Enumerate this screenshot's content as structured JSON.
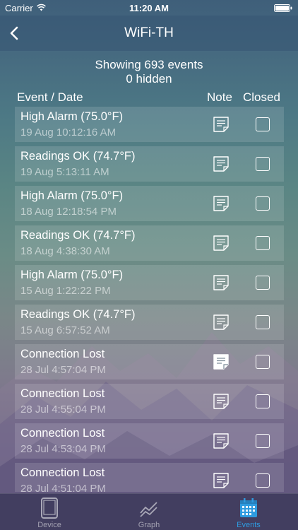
{
  "status_bar": {
    "carrier": "Carrier",
    "time": "11:20 AM"
  },
  "nav": {
    "title": "WiFi-TH"
  },
  "summary": {
    "showing": "Showing 693 events",
    "hidden": "0 hidden"
  },
  "columns": {
    "event": "Event / Date",
    "note": "Note",
    "closed": "Closed"
  },
  "events": [
    {
      "title": "High Alarm (75.0°F)",
      "date": "19 Aug 10:12:16 AM",
      "has_note": false,
      "closed": false
    },
    {
      "title": "Readings OK (74.7°F)",
      "date": "19 Aug 5:13:11 AM",
      "has_note": false,
      "closed": false
    },
    {
      "title": "High Alarm (75.0°F)",
      "date": "18 Aug 12:18:54 PM",
      "has_note": false,
      "closed": false
    },
    {
      "title": "Readings OK (74.7°F)",
      "date": "18 Aug 4:38:30 AM",
      "has_note": false,
      "closed": false
    },
    {
      "title": "High Alarm (75.0°F)",
      "date": "15 Aug 1:22:22 PM",
      "has_note": false,
      "closed": false
    },
    {
      "title": "Readings OK (74.7°F)",
      "date": "15 Aug 6:57:52 AM",
      "has_note": false,
      "closed": false
    },
    {
      "title": "Connection Lost",
      "date": "28 Jul 4:57:04 PM",
      "has_note": true,
      "closed": false
    },
    {
      "title": "Connection Lost",
      "date": "28 Jul 4:55:04 PM",
      "has_note": false,
      "closed": false
    },
    {
      "title": "Connection Lost",
      "date": "28 Jul 4:53:04 PM",
      "has_note": false,
      "closed": false
    },
    {
      "title": "Connection Lost",
      "date": "28 Jul 4:51:04 PM",
      "has_note": false,
      "closed": false
    }
  ],
  "tabs": [
    {
      "label": "Device",
      "icon": "tablet-icon",
      "active": false
    },
    {
      "label": "Graph",
      "icon": "graph-icon",
      "active": false
    },
    {
      "label": "Events",
      "icon": "calendar-icon",
      "active": true
    }
  ],
  "colors": {
    "accent": "#2e9be0"
  }
}
